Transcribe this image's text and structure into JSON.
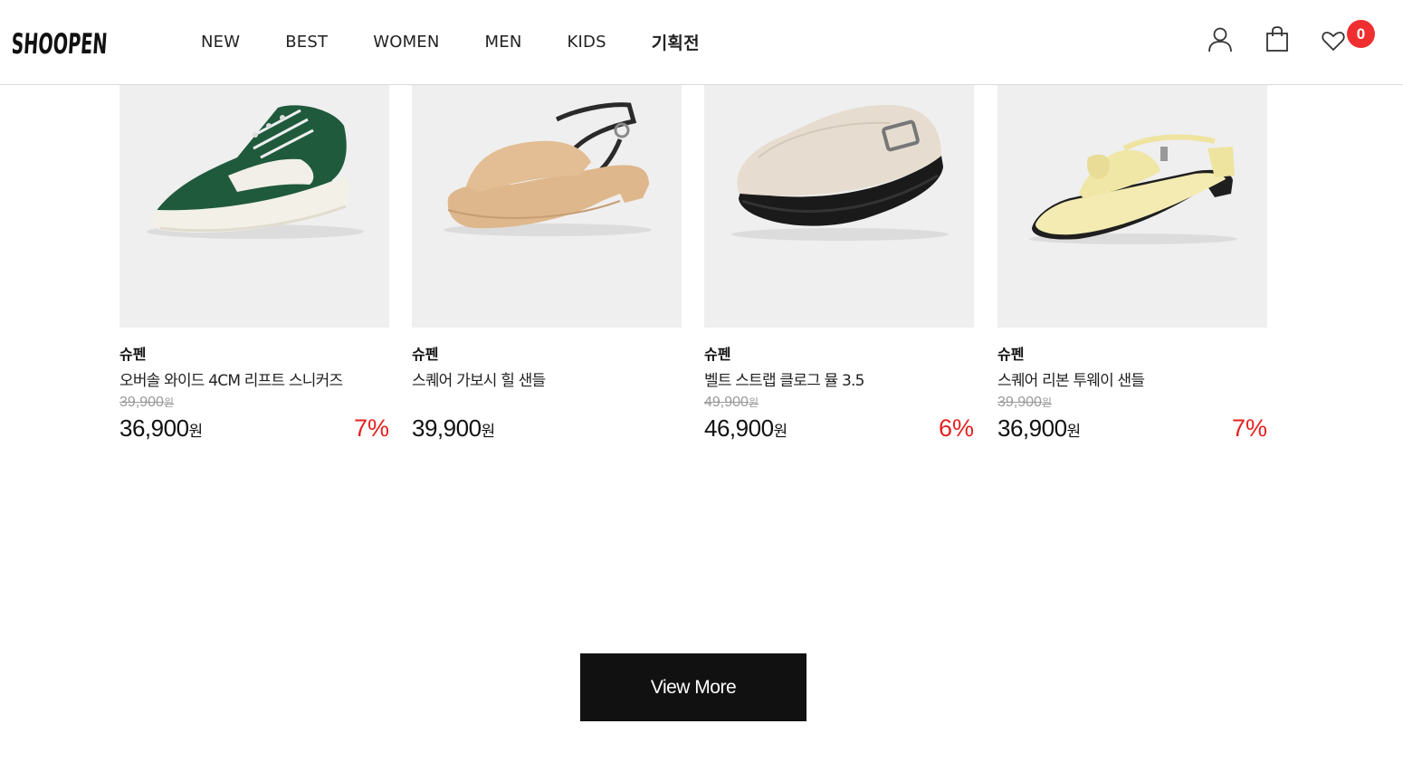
{
  "header": {
    "logo_text": "SHOOPEN",
    "nav": [
      {
        "label": "NEW"
      },
      {
        "label": "BEST"
      },
      {
        "label": "WOMEN"
      },
      {
        "label": "MEN"
      },
      {
        "label": "KIDS"
      },
      {
        "label": "기획전"
      }
    ],
    "icons": [
      "user-icon",
      "shopping-bag-icon",
      "heart-icon"
    ],
    "wishlist_count": "0",
    "badge_color": "#ef2f2f"
  },
  "products": [
    {
      "brand": "슈펜",
      "name": "오버솔 와이드 4CM 리프트 스니커즈",
      "original_price": "39,900",
      "original_unit": "원",
      "price": "36,900",
      "price_unit": "원",
      "discount": "7%",
      "image": "green-sneaker"
    },
    {
      "brand": "슈펜",
      "name": "스퀘어 가보시 힐 샌들",
      "original_price": "",
      "original_unit": "",
      "price": "39,900",
      "price_unit": "원",
      "discount": "",
      "image": "beige-sandal"
    },
    {
      "brand": "슈펜",
      "name": "벨트 스트랩 클로그 뮬 3.5",
      "original_price": "49,900",
      "original_unit": "원",
      "price": "46,900",
      "price_unit": "원",
      "discount": "6%",
      "image": "cream-clog"
    },
    {
      "brand": "슈펜",
      "name": "스퀘어 리본 투웨이 샌들",
      "original_price": "39,900",
      "original_unit": "원",
      "price": "36,900",
      "price_unit": "원",
      "discount": "7%",
      "image": "yellow-ribbon-sandal"
    }
  ],
  "view_more_label": "View More",
  "colors": {
    "accent_discount": "#e62020",
    "button_bg": "#111111",
    "thumb_bg": "#efefef"
  }
}
